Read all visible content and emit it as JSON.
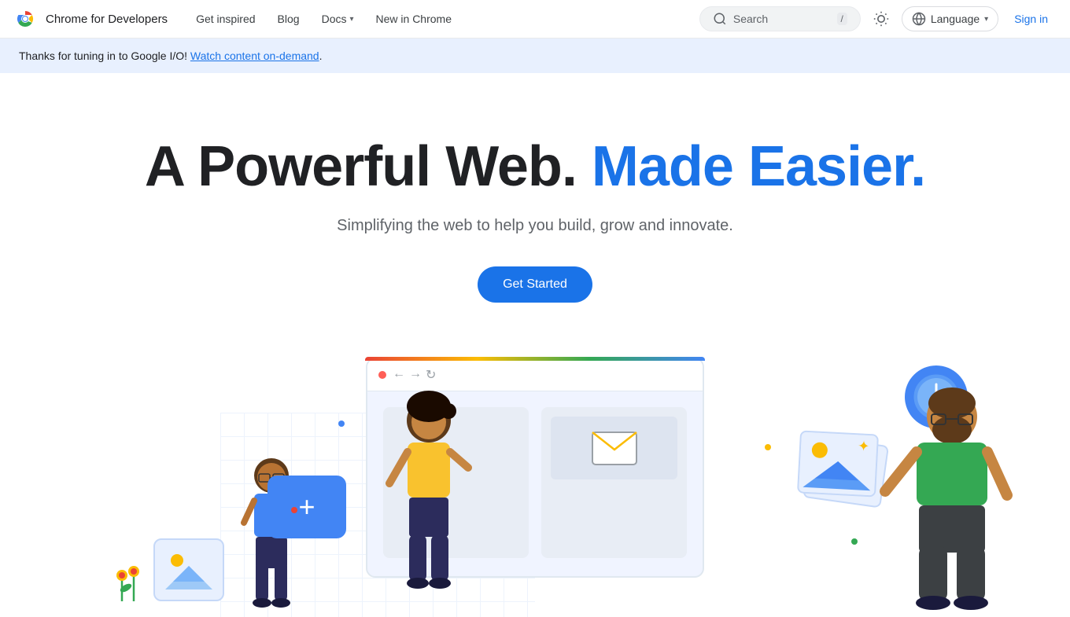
{
  "header": {
    "logo_text": "Chrome for Developers",
    "nav_items": [
      {
        "label": "Get inspired",
        "has_dropdown": false
      },
      {
        "label": "Blog",
        "has_dropdown": false
      },
      {
        "label": "Docs",
        "has_dropdown": true
      },
      {
        "label": "New in Chrome",
        "has_dropdown": false
      }
    ],
    "search": {
      "placeholder": "Search",
      "shortcut": "/"
    },
    "language_label": "Language",
    "sign_in_label": "Sign in"
  },
  "banner": {
    "text_before_link": "Thanks for tuning in to Google I/O! ",
    "link_text": "Watch content on-demand",
    "text_after_link": "."
  },
  "hero": {
    "title_part1": "A Powerful Web. ",
    "title_part2": "Made Easier.",
    "subtitle": "Simplifying the web to help you build, grow and innovate.",
    "cta_label": "Get Started"
  },
  "colors": {
    "blue": "#1a73e8",
    "dark_text": "#202124",
    "muted_text": "#5f6368",
    "banner_bg": "#e8f0fe",
    "nav_hover": "#f1f3f4"
  },
  "illustration": {
    "browser_nav_back": "←",
    "browser_nav_forward": "→",
    "browser_nav_refresh": "↻",
    "plus_symbol": "+",
    "clock_label": "clock"
  }
}
